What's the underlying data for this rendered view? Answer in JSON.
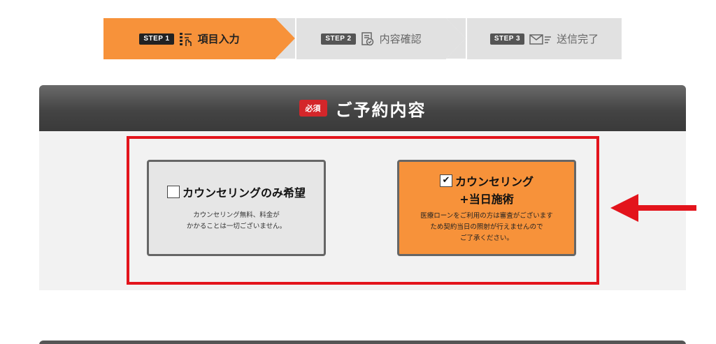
{
  "steps": [
    {
      "badge": "STEP 1",
      "label": "項目入力",
      "icon": "form-input-icon",
      "active": true
    },
    {
      "badge": "STEP 2",
      "label": "内容確認",
      "icon": "document-check-icon",
      "active": false
    },
    {
      "badge": "STEP 3",
      "label": "送信完了",
      "icon": "envelope-send-icon",
      "active": false
    }
  ],
  "section": {
    "required": "必須",
    "title": "ご予約内容"
  },
  "options": [
    {
      "title": "カウンセリングのみ希望",
      "desc_line1": "カウンセリング無料、料金が",
      "desc_line2": "かかることは一切ございません。",
      "checked": false,
      "check_mark": ""
    },
    {
      "title": "カウンセリング",
      "title_line2": "+当日施術",
      "desc_line1": "医療ローンをご利用の方は審査がございます",
      "desc_line2": "ため契約当日の照射が行えませんので",
      "desc_line3": "ご了承ください。",
      "checked": true,
      "check_mark": "✔"
    }
  ],
  "colors": {
    "accent_orange": "#f7923a",
    "step_inactive": "#e1e1e1",
    "required_red": "#d4262a",
    "highlight_red": "#e3141c",
    "header_dark": "#444444"
  }
}
